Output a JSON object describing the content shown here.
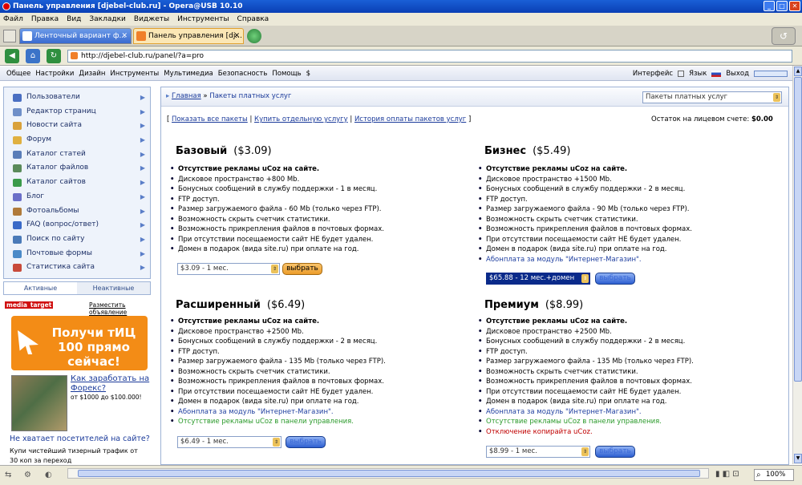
{
  "window": {
    "title": "Панель управления [djebel-club.ru] - Opera@USB 10.10"
  },
  "menu": [
    "Файл",
    "Правка",
    "Вид",
    "Закладки",
    "Виджеты",
    "Инструменты",
    "Справка"
  ],
  "tabs": [
    {
      "label": "Ленточный вариант ф...",
      "close": "✕"
    },
    {
      "label": "Панель управления [dj...",
      "close": "✕"
    }
  ],
  "address": {
    "url": "http://djebel-club.ru/panel/?a=pro"
  },
  "panel_menu": {
    "left": [
      "Общее",
      "Настройки",
      "Дизайн",
      "Инструменты",
      "Мультимедиа",
      "Безопасность",
      "Помощь",
      "$"
    ],
    "interface": "Интерфейс",
    "lang": "Язык",
    "logout": "Выход"
  },
  "sidebar": {
    "items": [
      {
        "label": "Пользователи",
        "color": "#4a6fc2"
      },
      {
        "label": "Редактор страниц",
        "color": "#6f8fc8"
      },
      {
        "label": "Новости сайта",
        "color": "#d9a13b"
      },
      {
        "label": "Форум",
        "color": "#e0b040"
      },
      {
        "label": "Каталог статей",
        "color": "#5a7db8"
      },
      {
        "label": "Каталог файлов",
        "color": "#5a8a5a"
      },
      {
        "label": "Каталог сайтов",
        "color": "#3a9a4a"
      },
      {
        "label": "Блог",
        "color": "#6a6fc8"
      },
      {
        "label": "Фотоальбомы",
        "color": "#b07a3a"
      },
      {
        "label": "FAQ (вопрос/ответ)",
        "color": "#3a6ac8"
      },
      {
        "label": "Поиск по сайту",
        "color": "#4a7ab8"
      },
      {
        "label": "Почтовые формы",
        "color": "#4a8ac8"
      },
      {
        "label": "Статистика сайта",
        "color": "#c84a3a"
      }
    ],
    "tab_active": "Активные",
    "tab_inactive": "Неактивные"
  },
  "ad": {
    "brand": "media",
    "brand2": "target",
    "place": "Разместить объявление",
    "banner": "Получи тИЦ 100 прямо сейчас!",
    "link1": "Как заработать на Форекс?",
    "sub1": "от $1000 до $100.000!",
    "link2": "Не хватает посетителей на сайте?",
    "sub2": "Купи чистейший тизерный трафик от",
    "sub3": "30 коп за переход"
  },
  "crumb": {
    "home": "Главная",
    "sep": "»",
    "current": "Пакеты платных услуг",
    "select": "Пакеты платных услуг"
  },
  "top_links": {
    "open": "[",
    "all": "Показать все пакеты",
    "sep": "|",
    "one": "Купить отдельную услугу",
    "history": "История оплаты пакетов услуг",
    "close": "]",
    "balance_label": "Остаток на лицевом счете:",
    "balance": "$0.00"
  },
  "plans": {
    "basic": {
      "name": "Базовый",
      "price": "($3.09)",
      "select": "$3.09 - 1 мес.",
      "btn": "выбрать",
      "features": [
        [
          "Отсутствие рекламы uCoz на сайте.",
          "b"
        ],
        [
          "Дисковое пространство +800 Mb.",
          "n"
        ],
        [
          "Бонусных сообщений в службу поддержки - 1 в месяц.",
          "n"
        ],
        [
          "FTP доступ.",
          "n"
        ],
        [
          "Размер загружаемого файла - 60 Mb (только через FTP).",
          "n"
        ],
        [
          "Возможность скрыть счетчик статистики.",
          "n"
        ],
        [
          "Возможность прикрепления файлов в почтовых формах.",
          "n"
        ],
        [
          "При отсутствии посещаемости сайт НЕ будет удален.",
          "n"
        ],
        [
          "Домен в подарок (вида site.ru) при оплате на год.",
          "n"
        ]
      ]
    },
    "business": {
      "name": "Бизнес",
      "price": "($5.49)",
      "select": "$65.88 - 12 мес.+домен",
      "btn": "выбрать",
      "features": [
        [
          "Отсутствие рекламы uCoz на сайте.",
          "b"
        ],
        [
          "Дисковое пространство +1500 Mb.",
          "n"
        ],
        [
          "Бонусных сообщений в службу поддержки - 2 в месяц.",
          "n"
        ],
        [
          "FTP доступ.",
          "n"
        ],
        [
          "Размер загружаемого файла - 90 Mb (только через FTP).",
          "n"
        ],
        [
          "Возможность скрыть счетчик статистики.",
          "n"
        ],
        [
          "Возможность прикрепления файлов в почтовых формах.",
          "n"
        ],
        [
          "При отсутствии посещаемости сайт НЕ будет удален.",
          "n"
        ],
        [
          "Домен в подарок (вида site.ru) при оплате на год.",
          "n"
        ],
        [
          "Абонплата за модуль \"Интернет-Магазин\".",
          "blue"
        ]
      ]
    },
    "extended": {
      "name": "Расширенный",
      "price": "($6.49)",
      "select": "$6.49 - 1 мес.",
      "btn": "выбрать",
      "features": [
        [
          "Отсутствие рекламы uCoz на сайте.",
          "b"
        ],
        [
          "Дисковое пространство +2500 Mb.",
          "n"
        ],
        [
          "Бонусных сообщений в службу поддержки - 2 в месяц.",
          "n"
        ],
        [
          "FTP доступ.",
          "n"
        ],
        [
          "Размер загружаемого файла - 135 Mb (только через FTP).",
          "n"
        ],
        [
          "Возможность скрыть счетчик статистики.",
          "n"
        ],
        [
          "Возможность прикрепления файлов в почтовых формах.",
          "n"
        ],
        [
          "При отсутствии посещаемости сайт НЕ будет удален.",
          "n"
        ],
        [
          "Домен в подарок (вида site.ru) при оплате на год.",
          "n"
        ],
        [
          "Абонплата за модуль \"Интернет-Магазин\".",
          "blue"
        ],
        [
          "Отсутствие рекламы uCoz в панели управления.",
          "green"
        ]
      ]
    },
    "premium": {
      "name": "Премиум",
      "price": "($8.99)",
      "select": "$8.99 - 1 мес.",
      "btn": "выбрать",
      "features": [
        [
          "Отсутствие рекламы uCoz на сайте.",
          "b"
        ],
        [
          "Дисковое пространство +2500 Mb.",
          "n"
        ],
        [
          "Бонусных сообщений в службу поддержки - 2 в месяц.",
          "n"
        ],
        [
          "FTP доступ.",
          "n"
        ],
        [
          "Размер загружаемого файла - 135 Mb (только через FTP).",
          "n"
        ],
        [
          "Возможность скрыть счетчик статистики.",
          "n"
        ],
        [
          "Возможность прикрепления файлов в почтовых формах.",
          "n"
        ],
        [
          "При отсутствии посещаемости сайт НЕ будет удален.",
          "n"
        ],
        [
          "Домен в подарок (вида site.ru) при оплате на год.",
          "n"
        ],
        [
          "Абонплата за модуль \"Интернет-Магазин\".",
          "blue"
        ],
        [
          "Отсутствие рекламы uCoz в панели управления.",
          "green"
        ],
        [
          "Отключение копирайта uCoz.",
          "red"
        ]
      ]
    }
  },
  "status": {
    "zoom": "100%"
  }
}
